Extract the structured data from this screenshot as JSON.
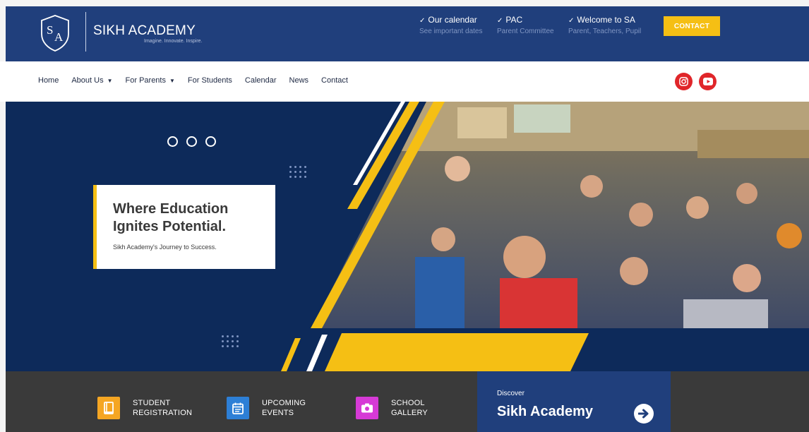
{
  "header": {
    "brand_name": "SIKH ACADEMY",
    "brand_tagline": "Imagine. Innovate. Inspire.",
    "logo_icon": "sa-shield-logo",
    "info_items": [
      {
        "title": "Our calendar",
        "subtitle": "See important dates"
      },
      {
        "title": "PAC",
        "subtitle": "Parent Committee"
      },
      {
        "title": "Welcome to SA",
        "subtitle": "Parent, Teachers, Pupil"
      }
    ],
    "contact_label": "CONTACT",
    "colors": {
      "bar": "#203f7c",
      "accent": "#f5bf14"
    }
  },
  "nav": {
    "items": [
      {
        "label": "Home"
      },
      {
        "label": "About Us",
        "has_dropdown": true
      },
      {
        "label": "For Parents",
        "has_dropdown": true
      },
      {
        "label": "For Students"
      },
      {
        "label": "Calendar"
      },
      {
        "label": "News"
      },
      {
        "label": "Contact"
      }
    ],
    "social": [
      {
        "icon": "instagram-icon"
      },
      {
        "icon": "youtube-icon"
      }
    ]
  },
  "hero": {
    "title": "Where Education Ignites Potential.",
    "subtitle": "Sikh Academy's Journey to Success.",
    "slide_count": 3,
    "colors": {
      "navy": "#0d2a5a",
      "yellow": "#f5bf14"
    }
  },
  "quick_links": [
    {
      "line1": "STUDENT",
      "line2": "REGISTRATION",
      "icon": "book-icon",
      "color": "#f5a623"
    },
    {
      "line1": "UPCOMING",
      "line2": "EVENTS",
      "icon": "calendar-icon",
      "color": "#2d7fd6"
    },
    {
      "line1": "SCHOOL",
      "line2": "GALLERY",
      "icon": "camera-icon",
      "color": "#d63ad6"
    }
  ],
  "discover": {
    "small": "Discover",
    "big": "Sikh Academy",
    "icon": "arrow-right-icon"
  }
}
